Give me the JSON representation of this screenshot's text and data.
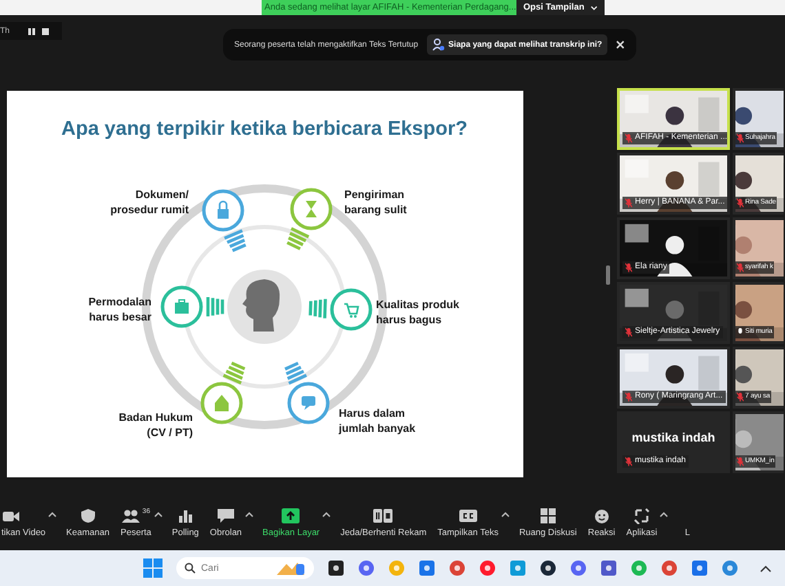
{
  "share_banner": {
    "text": "Anda sedang melihat layar AFIFAH - Kementerian Perdagang...",
    "button": "Opsi Tampilan"
  },
  "recording": {
    "label": "Th"
  },
  "notice": {
    "text": "Seorang peserta telah mengaktifkan Teks Tertutup",
    "link": "Siapa yang dapat melihat transkrip ini?"
  },
  "slide": {
    "title": "Apa yang terpikir ketika berbicara Ekspor?",
    "items": [
      {
        "lines": [
          "Dokumen/",
          "prosedur rumit"
        ]
      },
      {
        "lines": [
          "Pengiriman",
          "barang sulit"
        ]
      },
      {
        "lines": [
          "Permodalan",
          "harus besar"
        ]
      },
      {
        "lines": [
          "Kualitas produk",
          "harus bagus"
        ]
      },
      {
        "lines": [
          "Badan Hukum",
          "(CV / PT)"
        ]
      },
      {
        "lines": [
          "Harus dalam",
          "jumlah banyak"
        ]
      }
    ]
  },
  "gallery": [
    {
      "kind": "video",
      "name": "AFIFAH - Kementerian ...",
      "muted": true,
      "selected": true
    },
    {
      "kind": "video",
      "name": "Suhajahra",
      "muted": true,
      "selected": false
    },
    {
      "kind": "video",
      "name": "Herry | BANANA & Par...",
      "muted": true,
      "selected": false
    },
    {
      "kind": "video",
      "name": "Rina Sade",
      "muted": true,
      "selected": false
    },
    {
      "kind": "video",
      "name": "Ela riany",
      "muted": true,
      "selected": false
    },
    {
      "kind": "video",
      "name": "syarifah k",
      "muted": true,
      "selected": false
    },
    {
      "kind": "video",
      "name": "Sieltje-Artistica Jewelry",
      "muted": true,
      "selected": false
    },
    {
      "kind": "video",
      "name": "Siti muria",
      "muted": false,
      "selected": false
    },
    {
      "kind": "video",
      "name": "Rony ( Maringrang Art...",
      "muted": true,
      "selected": false
    },
    {
      "kind": "video",
      "name": "7 ayu sa",
      "muted": true,
      "selected": false
    },
    {
      "kind": "name_card",
      "display_name": "mustika indah",
      "name": "mustika indah",
      "muted": true,
      "selected": false
    },
    {
      "kind": "video",
      "name": "UMKM_in",
      "muted": true,
      "selected": false
    }
  ],
  "toolbar": [
    {
      "kind": "video",
      "label": "tikan Video",
      "caret": true,
      "active": false
    },
    {
      "kind": "security",
      "label": "Keamanan",
      "caret": false,
      "active": false
    },
    {
      "kind": "participants",
      "label": "Peserta",
      "count": "36",
      "caret": true,
      "active": false
    },
    {
      "kind": "polling",
      "label": "Polling",
      "caret": false,
      "active": false
    },
    {
      "kind": "chat",
      "label": "Obrolan",
      "caret": true,
      "active": false
    },
    {
      "kind": "share",
      "label": "Bagikan Layar",
      "caret": true,
      "active": true
    },
    {
      "kind": "record",
      "label": "Jeda/Berhenti Rekam",
      "caret": false,
      "active": false
    },
    {
      "kind": "captions",
      "label": "Tampilkan Teks",
      "caret": true,
      "active": false
    },
    {
      "kind": "rooms",
      "label": "Ruang Diskusi",
      "caret": false,
      "active": false
    },
    {
      "kind": "reactions",
      "label": "Reaksi",
      "caret": false,
      "active": false
    },
    {
      "kind": "apps",
      "label": "Aplikasi",
      "caret": true,
      "active": false
    },
    {
      "kind": "more",
      "label": "L",
      "caret": false,
      "active": false
    }
  ],
  "taskbar": {
    "search_placeholder": "Cari"
  }
}
